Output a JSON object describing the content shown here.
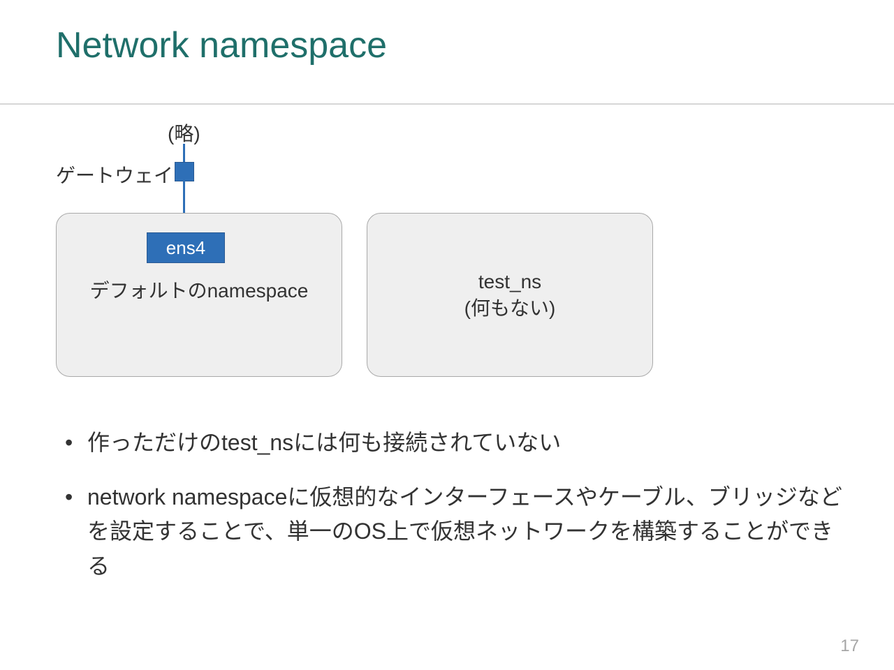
{
  "title": "Network namespace",
  "diagram": {
    "abbrev": "(略)",
    "gateway_label": "ゲートウェイ",
    "interface_label": "ens4",
    "default_ns_label": "デフォルトのnamespace",
    "test_ns_name": "test_ns",
    "test_ns_note": "(何もない)"
  },
  "bullets": [
    "作っただけのtest_nsには何も接続されていない",
    "network namespaceに仮想的なインターフェースやケーブル、ブリッジなどを設定することで、単一のOS上で仮想ネットワークを構築することができる"
  ],
  "page_number": "17"
}
